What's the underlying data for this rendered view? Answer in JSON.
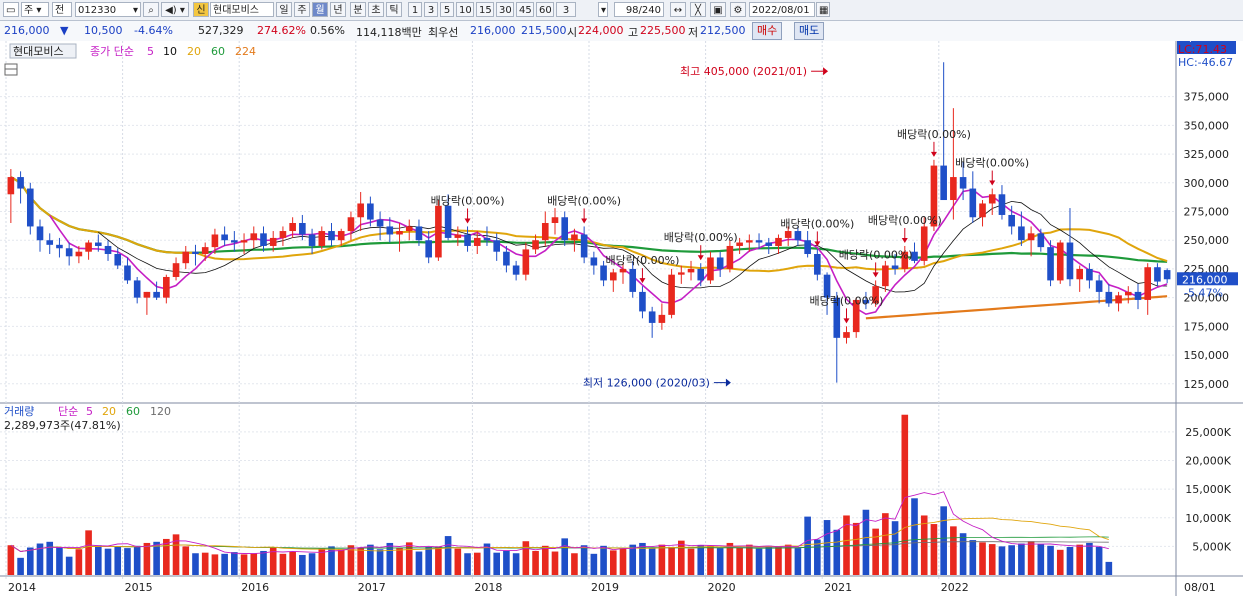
{
  "toolbar": {
    "market": "주",
    "period_sel": "전",
    "code": "012330",
    "signal_badge": "신",
    "stock_name": "현대모비스",
    "period_tabs": [
      "일",
      "주",
      "월",
      "년"
    ],
    "period_active": "월",
    "intraday_tabs": [
      "분",
      "초",
      "틱"
    ],
    "minute_opts": [
      "1",
      "3",
      "5",
      "10",
      "15",
      "30",
      "45",
      "60"
    ],
    "count": "3",
    "range": "98/240",
    "date": "2022/08/01"
  },
  "quote": {
    "price": "216,000",
    "arrow": "▼",
    "change": "10,500",
    "change_pct": "-4.64%",
    "volume": "527,329",
    "vol_ratio": "274.62%",
    "turnover": "0.56%",
    "amount": "114,118백만",
    "best_ask_label": "최우선",
    "best_ask": "216,000",
    "best_bid": "215,500",
    "open_label": "시",
    "open": "224,000",
    "high_label": "고",
    "high": "225,500",
    "low_label": "저",
    "low": "212,500",
    "buy_label": "매수",
    "sell_label": "매도"
  },
  "price_panel": {
    "legend_name": "현대모비스",
    "legend_ma": "종가 단순",
    "ma_periods": [
      "5",
      "10",
      "20",
      "60",
      "224"
    ],
    "lc": "LC:71.43",
    "hc": "HC:-46.67",
    "current_price_label": "216,000",
    "current_pct_label": "-5.47%",
    "annot_high": "최고 405,000 (2021/01)",
    "annot_low": "최저 126,000 (2020/03)",
    "dividend_label": "배당락(0.00%)"
  },
  "volume_panel": {
    "legend_name": "거래량",
    "legend_ma": "단순",
    "ma_periods": [
      "5",
      "20",
      "60",
      "120"
    ],
    "info": "2,289,973주(47.81%)",
    "current_label": "2,290K",
    "current_pct": "47.81%"
  },
  "colors": {
    "up": "#e8281e",
    "down": "#1f4fc8",
    "ma5": "#c51fc5",
    "ma10": "#111111",
    "ma20": "#e0a50c",
    "ma60": "#1e9a3a",
    "ma224": "#e37a1b",
    "annot_high": "#d0021b",
    "annot_low": "#0a2a9c"
  },
  "chart_data": [
    {
      "type": "candlestick",
      "title": "현대모비스 월봉",
      "y_ticks": [
        125000,
        150000,
        175000,
        200000,
        225000,
        250000,
        275000,
        300000,
        325000,
        350000,
        375000
      ],
      "ylim": [
        110000,
        420000
      ],
      "x_labels": [
        "2014",
        "2015",
        "2016",
        "2017",
        "2018",
        "2019",
        "2020",
        "2021",
        "2022",
        "08/01"
      ],
      "annotations": {
        "high": {
          "value": 405000,
          "date": "2021/01"
        },
        "low": {
          "value": 126000,
          "date": "2020/03"
        }
      },
      "dividend_marks": [
        "2017/12",
        "2018/12",
        "2019/06",
        "2019/12",
        "2020/12",
        "2021/03",
        "2021/06",
        "2021/09",
        "2021/12",
        "2022/06"
      ],
      "series": [
        {
          "name": "candles",
          "ohlc": [
            [
              290000,
              312000,
              265000,
              305000
            ],
            [
              305000,
              310000,
              282000,
              295000
            ],
            [
              295000,
              300000,
              255000,
              262000
            ],
            [
              262000,
              268000,
              240000,
              250000
            ],
            [
              250000,
              256000,
              238000,
              246000
            ],
            [
              246000,
              252000,
              235000,
              243000
            ],
            [
              243000,
              248000,
              228000,
              236000
            ],
            [
              236000,
              245000,
              230000,
              240000
            ],
            [
              240000,
              250000,
              233000,
              248000
            ],
            [
              248000,
              255000,
              240000,
              245000
            ],
            [
              245000,
              250000,
              232000,
              238000
            ],
            [
              238000,
              243000,
              225000,
              228000
            ],
            [
              228000,
              235000,
              212000,
              215000
            ],
            [
              215000,
              218000,
              195000,
              200000
            ],
            [
              200000,
              205000,
              185000,
              205000
            ],
            [
              205000,
              214000,
              198000,
              200000
            ],
            [
              200000,
              220000,
              195000,
              218000
            ],
            [
              218000,
              235000,
              215000,
              230000
            ],
            [
              230000,
              245000,
              225000,
              240000
            ],
            [
              240000,
              246000,
              228000,
              238000
            ],
            [
              238000,
              248000,
              232000,
              244000
            ],
            [
              244000,
              260000,
              238000,
              255000
            ],
            [
              255000,
              262000,
              245000,
              250000
            ],
            [
              250000,
              258000,
              240000,
              248000
            ],
            [
              248000,
              256000,
              238000,
              250000
            ],
            [
              250000,
              262000,
              243000,
              256000
            ],
            [
              256000,
              262000,
              240000,
              245000
            ],
            [
              245000,
              258000,
              240000,
              252000
            ],
            [
              252000,
              262000,
              245000,
              258000
            ],
            [
              258000,
              270000,
              252000,
              265000
            ],
            [
              265000,
              272000,
              250000,
              255000
            ],
            [
              255000,
              260000,
              238000,
              245000
            ],
            [
              245000,
              262000,
              242000,
              258000
            ],
            [
              258000,
              265000,
              245000,
              250000
            ],
            [
              250000,
              260000,
              245000,
              258000
            ],
            [
              258000,
              275000,
              250000,
              270000
            ],
            [
              270000,
              292000,
              258000,
              282000
            ],
            [
              282000,
              288000,
              262000,
              268000
            ],
            [
              268000,
              275000,
              250000,
              262000
            ],
            [
              262000,
              270000,
              248000,
              255000
            ],
            [
              255000,
              265000,
              240000,
              258000
            ],
            [
              258000,
              268000,
              250000,
              262000
            ],
            [
              262000,
              268000,
              245000,
              250000
            ],
            [
              250000,
              258000,
              230000,
              235000
            ],
            [
              235000,
              285000,
              232000,
              280000
            ],
            [
              280000,
              290000,
              250000,
              252000
            ],
            [
              252000,
              262000,
              245000,
              255000
            ],
            [
              255000,
              262000,
              240000,
              245000
            ],
            [
              245000,
              258000,
              238000,
              252000
            ],
            [
              252000,
              262000,
              245000,
              250000
            ],
            [
              250000,
              256000,
              232000,
              240000
            ],
            [
              240000,
              245000,
              222000,
              228000
            ],
            [
              228000,
              232000,
              215000,
              220000
            ],
            [
              220000,
              248000,
              215000,
              242000
            ],
            [
              242000,
              255000,
              238000,
              250000
            ],
            [
              250000,
              275000,
              245000,
              265000
            ],
            [
              265000,
              278000,
              255000,
              270000
            ],
            [
              270000,
              275000,
              245000,
              250000
            ],
            [
              250000,
              260000,
              240000,
              255000
            ],
            [
              255000,
              262000,
              230000,
              235000
            ],
            [
              235000,
              240000,
              220000,
              228000
            ],
            [
              228000,
              232000,
              210000,
              215000
            ],
            [
              215000,
              225000,
              205000,
              222000
            ],
            [
              222000,
              230000,
              212000,
              225000
            ],
            [
              225000,
              232000,
              200000,
              205000
            ],
            [
              205000,
              210000,
              182000,
              188000
            ],
            [
              188000,
              192000,
              165000,
              178000
            ],
            [
              178000,
              195000,
              172000,
              185000
            ],
            [
              185000,
              225000,
              182000,
              220000
            ],
            [
              220000,
              228000,
              212000,
              222000
            ],
            [
              222000,
              232000,
              215000,
              225000
            ],
            [
              225000,
              230000,
              210000,
              215000
            ],
            [
              215000,
              240000,
              212000,
              235000
            ],
            [
              235000,
              240000,
              218000,
              225000
            ],
            [
              225000,
              250000,
              222000,
              245000
            ],
            [
              245000,
              252000,
              238000,
              248000
            ],
            [
              248000,
              255000,
              240000,
              250000
            ],
            [
              250000,
              256000,
              242000,
              248000
            ],
            [
              248000,
              252000,
              238000,
              245000
            ],
            [
              245000,
              255000,
              238000,
              252000
            ],
            [
              252000,
              262000,
              245000,
              258000
            ],
            [
              258000,
              262000,
              245000,
              250000
            ],
            [
              250000,
              258000,
              235000,
              238000
            ],
            [
              238000,
              242000,
              215000,
              220000
            ],
            [
              220000,
              222000,
              185000,
              200000
            ],
            [
              200000,
              205000,
              126000,
              165000
            ],
            [
              165000,
              175000,
              160000,
              170000
            ],
            [
              170000,
              200000,
              165000,
              198000
            ],
            [
              198000,
              205000,
              190000,
              195000
            ],
            [
              195000,
              215000,
              192000,
              210000
            ],
            [
              210000,
              232000,
              205000,
              228000
            ],
            [
              228000,
              238000,
              220000,
              225000
            ],
            [
              225000,
              245000,
              222000,
              240000
            ],
            [
              240000,
              248000,
              230000,
              232000
            ],
            [
              232000,
              270000,
              228000,
              262000
            ],
            [
              262000,
              320000,
              258000,
              315000
            ],
            [
              315000,
              405000,
              285000,
              285000
            ],
            [
              285000,
              365000,
              268000,
              305000
            ],
            [
              305000,
              318000,
              285000,
              295000
            ],
            [
              295000,
              310000,
              265000,
              270000
            ],
            [
              270000,
              285000,
              262000,
              282000
            ],
            [
              282000,
              295000,
              272000,
              290000
            ],
            [
              290000,
              298000,
              268000,
              272000
            ],
            [
              272000,
              280000,
              255000,
              262000
            ],
            [
              262000,
              275000,
              245000,
              250000
            ],
            [
              250000,
              262000,
              236000,
              256000
            ],
            [
              256000,
              260000,
              240000,
              244000
            ],
            [
              244000,
              250000,
              210000,
              215000
            ],
            [
              215000,
              250000,
              212000,
              248000
            ],
            [
              248000,
              278000,
              210000,
              216000
            ],
            [
              216000,
              228000,
              205000,
              225000
            ],
            [
              225000,
              230000,
              208000,
              215000
            ],
            [
              215000,
              220000,
              195000,
              205000
            ],
            [
              205000,
              212000,
              192000,
              195000
            ],
            [
              195000,
              205000,
              188000,
              202000
            ],
            [
              202000,
              210000,
              195000,
              205000
            ],
            [
              205000,
              212000,
              190000,
              198000
            ],
            [
              198000,
              230000,
              185000,
              226500
            ],
            [
              226500,
              230000,
              210000,
              214000
            ],
            [
              224000,
              225500,
              212500,
              216000
            ]
          ]
        }
      ]
    },
    {
      "type": "bar",
      "title": "거래량",
      "y_ticks": [
        5000,
        10000,
        15000,
        20000,
        25000
      ],
      "y_unit": "K",
      "ylim": [
        0,
        29000
      ],
      "series": [
        {
          "name": "volume",
          "values": [
            5200,
            3000,
            4800,
            5500,
            5800,
            4900,
            3200,
            4500,
            7800,
            5200,
            4600,
            5000,
            4700,
            5100,
            5600,
            5800,
            6300,
            7100,
            5000,
            3800,
            3900,
            3600,
            3700,
            4000,
            3600,
            3800,
            4200,
            4800,
            3700,
            4100,
            3500,
            3800,
            4600,
            5000,
            4500,
            5200,
            4700,
            5300,
            4500,
            5600,
            4800,
            5700,
            4100,
            4900,
            5000,
            6800,
            4600,
            3800,
            3900,
            5500,
            3900,
            4200,
            3800,
            5900,
            4200,
            5100,
            4100,
            6400,
            3800,
            5200,
            3700,
            5100,
            4300,
            4800,
            5300,
            5600,
            4800,
            5300,
            4900,
            6000,
            4600,
            5200,
            5100,
            4700,
            5600,
            4800,
            5300,
            4600,
            5100,
            4900,
            5300,
            4700,
            10200,
            6200,
            9600,
            7900,
            10400,
            9100,
            11400,
            8100,
            10800,
            9400,
            28000,
            13400,
            10400,
            8900,
            12000,
            8500,
            7300,
            6100,
            5700,
            5400,
            5000,
            5200,
            5500,
            5900,
            5400,
            5100,
            4400,
            4900,
            5300,
            5600,
            4900,
            2290
          ]
        }
      ]
    }
  ]
}
